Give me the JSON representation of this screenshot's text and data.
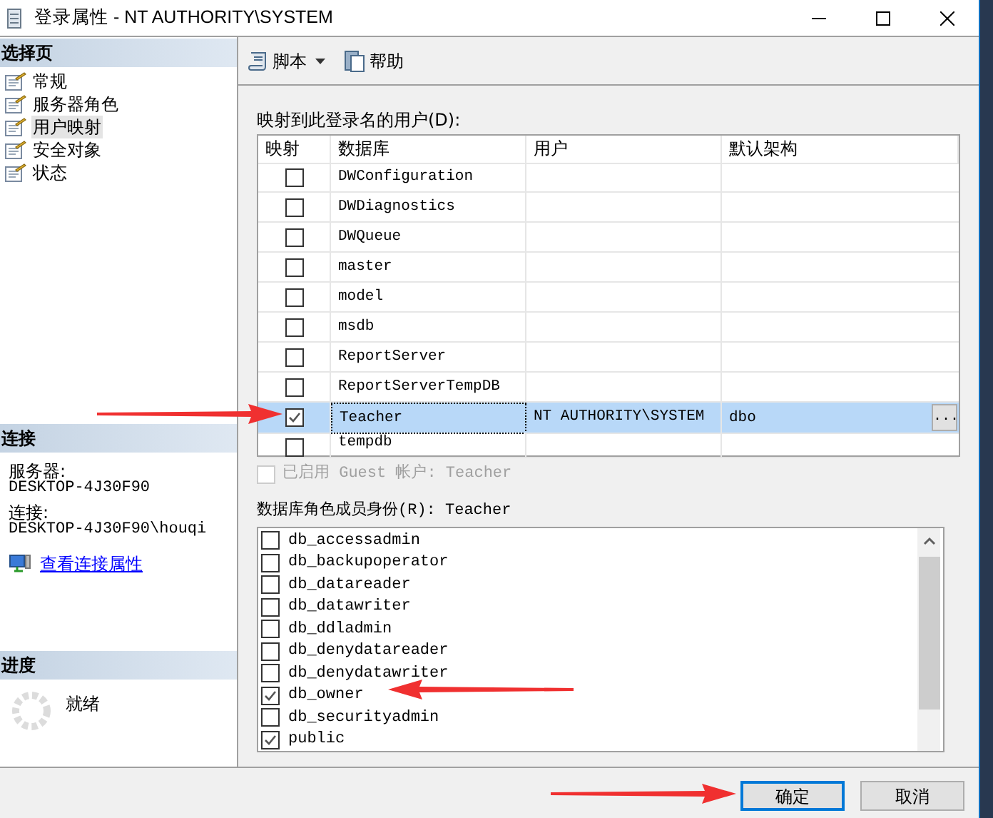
{
  "window": {
    "title": "登录属性 - NT AUTHORITY\\SYSTEM"
  },
  "sidebar": {
    "header": "选择页",
    "items": [
      {
        "label": "常规",
        "selected": false
      },
      {
        "label": "服务器角色",
        "selected": false
      },
      {
        "label": "用户映射",
        "selected": true
      },
      {
        "label": "安全对象",
        "selected": false
      },
      {
        "label": "状态",
        "selected": false
      }
    ]
  },
  "connection": {
    "header": "连接",
    "server_label": "服务器:",
    "server": "DESKTOP-4J30F90",
    "connection_label": "连接:",
    "connection": "DESKTOP-4J30F90\\houqi",
    "link": "查看连接属性"
  },
  "progress": {
    "header": "进度",
    "status": "就绪"
  },
  "toolbar": [
    {
      "label": "脚本",
      "kind": "script",
      "dropdown": true
    },
    {
      "label": "帮助",
      "kind": "help",
      "dropdown": false
    }
  ],
  "mapping": {
    "label": "映射到此登录名的用户(D):",
    "columns": [
      "映射",
      "数据库",
      "用户",
      "默认架构"
    ],
    "rows": [
      {
        "checked": false,
        "database": "DWConfiguration",
        "user": "",
        "schema": "",
        "selected": false
      },
      {
        "checked": false,
        "database": "DWDiagnostics",
        "user": "",
        "schema": "",
        "selected": false
      },
      {
        "checked": false,
        "database": "DWQueue",
        "user": "",
        "schema": "",
        "selected": false
      },
      {
        "checked": false,
        "database": "master",
        "user": "",
        "schema": "",
        "selected": false
      },
      {
        "checked": false,
        "database": "model",
        "user": "",
        "schema": "",
        "selected": false
      },
      {
        "checked": false,
        "database": "msdb",
        "user": "",
        "schema": "",
        "selected": false
      },
      {
        "checked": false,
        "database": "ReportServer",
        "user": "",
        "schema": "",
        "selected": false
      },
      {
        "checked": false,
        "database": "ReportServerTempDB",
        "user": "",
        "schema": "",
        "selected": false
      },
      {
        "checked": true,
        "database": "Teacher",
        "user": "NT AUTHORITY\\SYSTEM",
        "schema": "dbo",
        "schema_button": "...",
        "selected": true
      },
      {
        "checked": false,
        "database": "tempdb",
        "user": "",
        "schema": "",
        "selected": false
      }
    ]
  },
  "guest": {
    "label": "已启用 Guest 帐户: Teacher",
    "checked": false,
    "disabled": true
  },
  "roles": {
    "label": "数据库角色成员身份(R): Teacher",
    "items": [
      {
        "name": "db_accessadmin",
        "checked": false
      },
      {
        "name": "db_backupoperator",
        "checked": false
      },
      {
        "name": "db_datareader",
        "checked": false
      },
      {
        "name": "db_datawriter",
        "checked": false
      },
      {
        "name": "db_ddladmin",
        "checked": false
      },
      {
        "name": "db_denydatareader",
        "checked": false
      },
      {
        "name": "db_denydatawriter",
        "checked": false
      },
      {
        "name": "db_owner",
        "checked": true
      },
      {
        "name": "db_securityadmin",
        "checked": false
      },
      {
        "name": "public",
        "checked": true
      }
    ]
  },
  "buttons": [
    {
      "label": "确定",
      "default": true
    },
    {
      "label": "取消",
      "default": false
    }
  ]
}
